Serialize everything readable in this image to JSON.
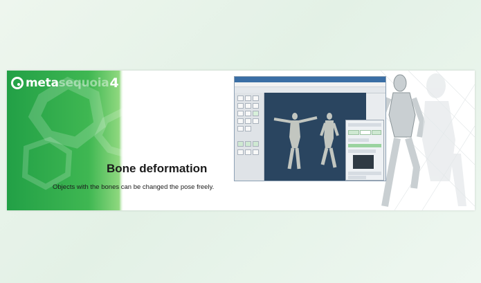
{
  "banner": {
    "logo": {
      "word_primary": "meta",
      "word_secondary": "sequoia",
      "version": "4"
    },
    "headline": "Bone deformation",
    "subline": "Objects with the bones can be changed the pose freely.",
    "colors": {
      "green_dark": "#2ca84a",
      "green_light": "#8fd87f",
      "viewport_blue": "#2a4560",
      "figure_gray": "#c9cfd2"
    },
    "icons": [
      "logo-mark-icon",
      "mannequin-figure"
    ]
  }
}
